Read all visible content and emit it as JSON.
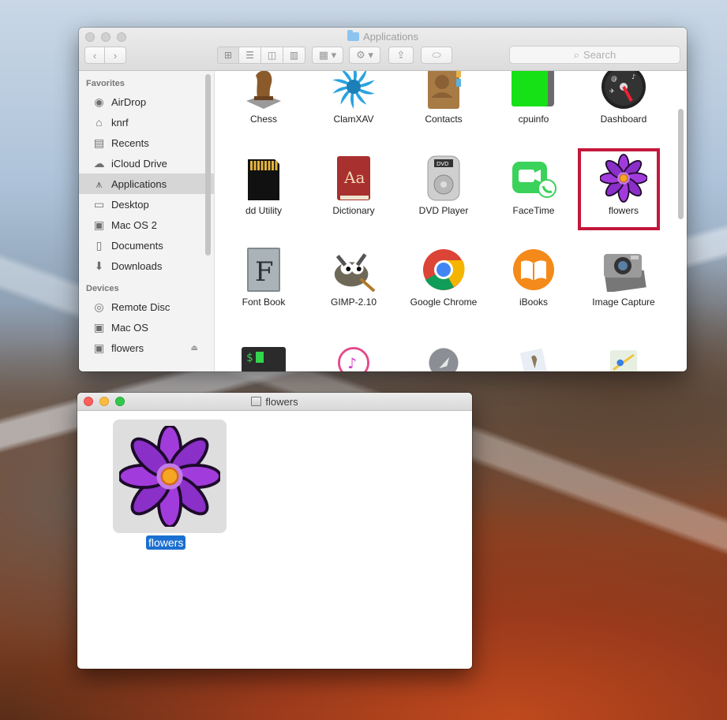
{
  "finder": {
    "title": "Applications",
    "search_placeholder": "Search",
    "sidebar": {
      "favorites_label": "Favorites",
      "favorites": [
        {
          "label": "AirDrop",
          "icon": "airdrop-icon"
        },
        {
          "label": "knrf",
          "icon": "home-icon"
        },
        {
          "label": "Recents",
          "icon": "recents-icon"
        },
        {
          "label": "iCloud Drive",
          "icon": "cloud-icon"
        },
        {
          "label": "Applications",
          "icon": "applications-icon"
        },
        {
          "label": "Desktop",
          "icon": "desktop-icon"
        },
        {
          "label": "Mac OS 2",
          "icon": "disk-icon"
        },
        {
          "label": "Documents",
          "icon": "documents-icon"
        },
        {
          "label": "Downloads",
          "icon": "downloads-icon"
        }
      ],
      "devices_label": "Devices",
      "devices": [
        {
          "label": "Remote Disc",
          "icon": "remote-disc-icon"
        },
        {
          "label": "Mac OS",
          "icon": "disk-icon"
        },
        {
          "label": "flowers",
          "icon": "disk-icon"
        }
      ]
    },
    "apps_row1": [
      "Chess",
      "ClamXAV",
      "Contacts",
      "cpuinfo",
      "Dashboard"
    ],
    "apps_row2": [
      "dd Utility",
      "Dictionary",
      "DVD Player",
      "FaceTime",
      "flowers"
    ],
    "apps_row3": [
      "Font Book",
      "GIMP-2.10",
      "Google Chrome",
      "iBooks",
      "Image Capture"
    ]
  },
  "flowers_window": {
    "title": "flowers",
    "item_label": "flowers"
  },
  "colors": {
    "highlight": "#c4173b",
    "selection": "#1b6fd0",
    "flower_petal": "#a23bdc"
  }
}
